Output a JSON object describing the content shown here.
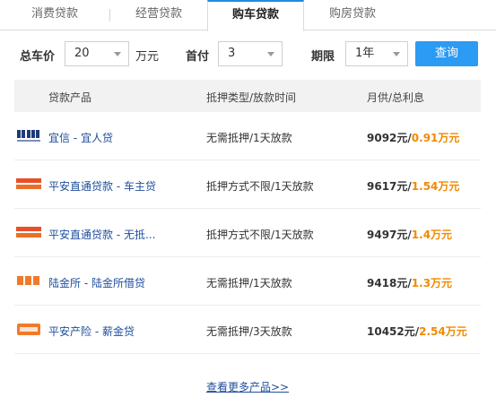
{
  "tabs": [
    {
      "label": "消费贷款",
      "active": false
    },
    {
      "label": "经营贷款",
      "active": false
    },
    {
      "label": "购车贷款",
      "active": true
    },
    {
      "label": "购房贷款",
      "active": false
    }
  ],
  "filters": {
    "price_label": "总车价",
    "price_value": "20",
    "price_unit": "万元",
    "down_label": "首付",
    "down_value": "3",
    "term_label": "期限",
    "term_value": "1年",
    "query_label": "查询"
  },
  "table": {
    "headers": [
      "贷款产品",
      "抵押类型/放款时间",
      "月供/总利息"
    ],
    "rows": [
      {
        "logo": "yixin-logo",
        "name": "宜信 - 宜人贷",
        "type": "无需抵押/1天放款",
        "monthly": "9092元/",
        "total": "0.91万元"
      },
      {
        "logo": "pingan-logo",
        "name": "平安直通贷款 - 车主贷",
        "type": "抵押方式不限/1天放款",
        "monthly": "9617元/",
        "total": "1.54万元"
      },
      {
        "logo": "pingan-logo",
        "name": "平安直通贷款 - 无抵...",
        "type": "抵押方式不限/1天放款",
        "monthly": "9497元/",
        "total": "1.4万元"
      },
      {
        "logo": "lufax-logo",
        "name": "陆金所 - 陆金所借贷",
        "type": "无需抵押/1天放款",
        "monthly": "9418元/",
        "total": "1.3万元"
      },
      {
        "logo": "pingan-insurance-logo",
        "name": "平安产险 - 薪金贷",
        "type": "无需抵押/3天放款",
        "monthly": "10452元/",
        "total": "2.54万元"
      }
    ],
    "more_link": "查看更多产品>>"
  },
  "colors": {
    "accent": "#2b9bf4",
    "link": "#1e4e9c",
    "highlight": "#f08a00"
  }
}
